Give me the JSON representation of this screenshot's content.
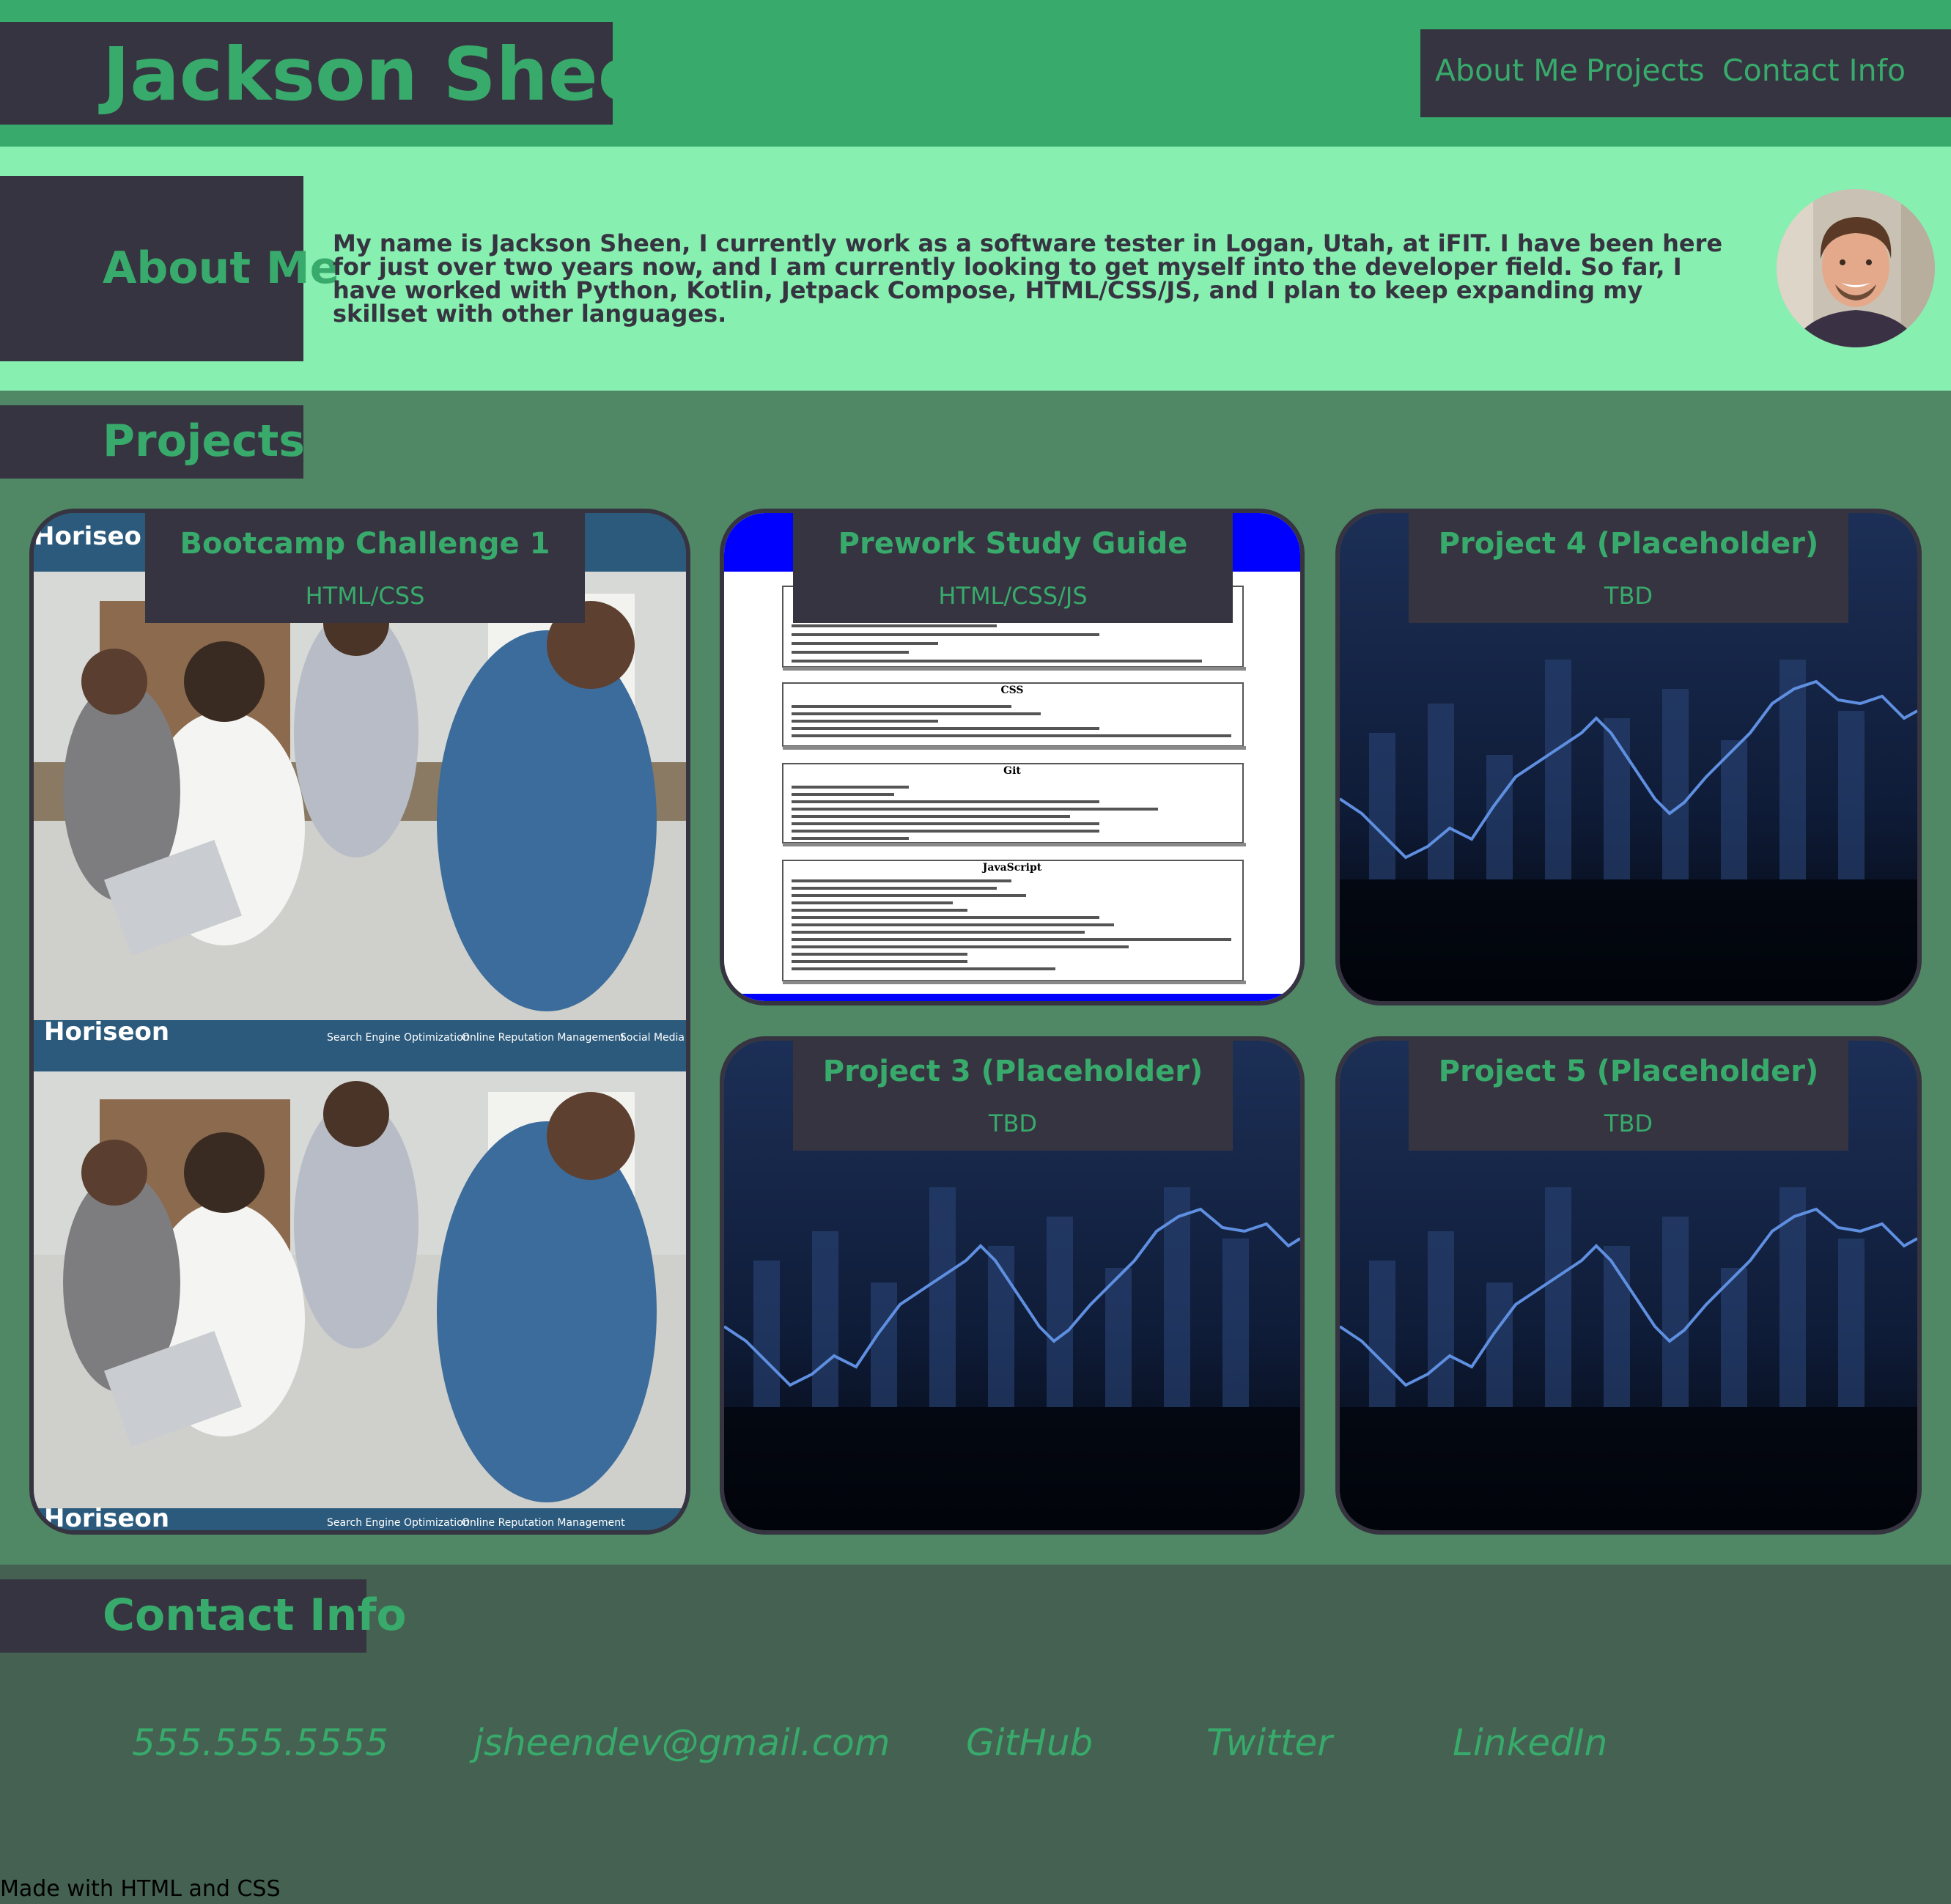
{
  "header": {
    "name": "Jackson Sheen",
    "nav": [
      "About Me",
      "Projects",
      "Contact Info"
    ]
  },
  "about": {
    "title": "About Me",
    "text": "My name is Jackson Sheen, I currently work as a software tester in Logan, Utah, at iFIT. I have been here for just over two years now, and I am currently looking to get myself into the developer field. So far, I have worked with Python, Kotlin, Jetpack Compose, HTML/CSS/JS, and I plan to keep expanding my skillset with other languages."
  },
  "projects": {
    "title": "Projects",
    "cards": [
      {
        "title": "Bootcamp Challenge 1",
        "subtitle": "HTML/CSS",
        "preview": "horiseon-screenshot"
      },
      {
        "title": "Prework Study Guide",
        "subtitle": "HTML/CSS/JS",
        "preview": "study-guide-screenshot"
      },
      {
        "title": "Project 4 (Placeholder)",
        "subtitle": "TBD",
        "preview": "stock-chart-image"
      },
      {
        "title": "Project 3 (Placeholder)",
        "subtitle": "TBD",
        "preview": "stock-chart-image"
      },
      {
        "title": "Project 5 (Placeholder)",
        "subtitle": "TBD",
        "preview": "stock-chart-image"
      }
    ],
    "horiseon": {
      "logo": "Horiseon",
      "logo_partial": "Horiseo",
      "nav": [
        "Search Engine Optimization",
        "Online Reputation Management",
        "Social Media Marketing"
      ]
    },
    "study_guide": {
      "sections": [
        "CSS",
        "Git",
        "JavaScript"
      ]
    }
  },
  "contact": {
    "title": "Contact Info",
    "phone": "555.555.5555",
    "email": "jsheendev@gmail.com",
    "github": "GitHub",
    "twitter": "Twitter",
    "linkedin": "LinkedIn"
  },
  "footer": {
    "text": "Made with HTML and CSS"
  },
  "colors": {
    "dark": "#363440",
    "green": "#38aa6b",
    "mint": "#87efb0",
    "projects_bg": "#508765",
    "contact_bg": "#446151"
  }
}
